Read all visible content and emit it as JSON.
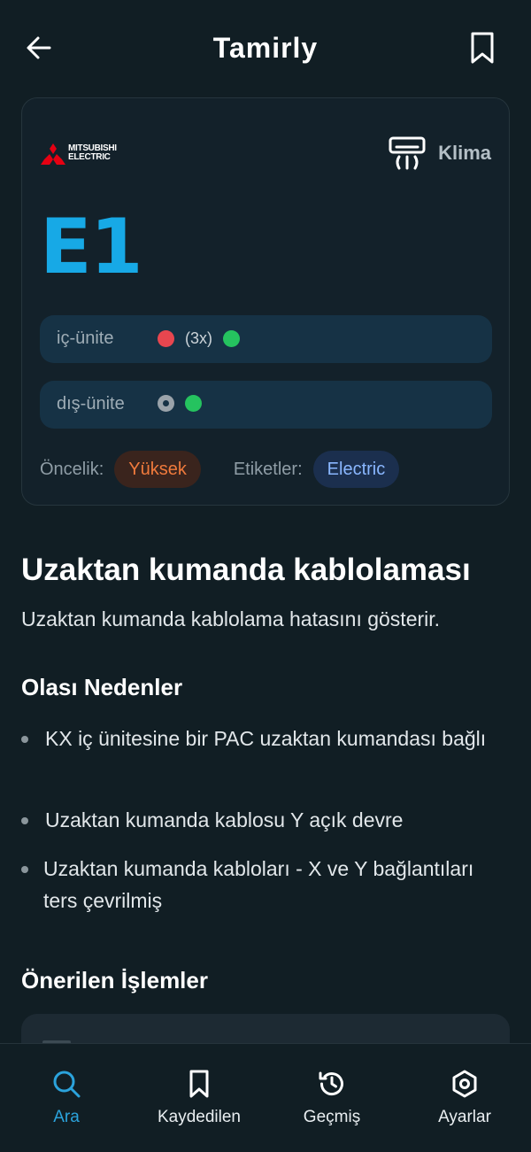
{
  "header": {
    "title": "Tamirly",
    "back_icon": "arrow-left-icon",
    "bookmark_icon": "bookmark-icon"
  },
  "card": {
    "brand_line1": "MITSUBISHI",
    "brand_line2": "ELECTRIC",
    "brand_logo_color": "#e60012",
    "category_icon": "air-conditioner-icon",
    "category": "Klima",
    "code": "E1",
    "code_color": "#17a9e6",
    "indoor": {
      "label": "iç-ünite",
      "blink": "(3x)"
    },
    "outdoor": {
      "label": "dış-ünite"
    },
    "priority_label": "Öncelik:",
    "priority": "Yüksek",
    "tags_label": "Etiketler:",
    "tag": "Electric"
  },
  "detail": {
    "title": "Uzaktan kumanda kablolaması",
    "description": "Uzaktan kumanda kablolama hatasını gösterir.",
    "causes_title": "Olası Nedenler",
    "causes": [
      "KX iç ünitesine bir PAC uzaktan kumandası bağlı",
      "Uzaktan kumanda kablosu Y açık devre",
      "Uzaktan kumanda kabloları - X ve Y bağlantıları ters çevrilmiş"
    ],
    "actions_title": "Önerilen İşlemler"
  },
  "nav": {
    "items": [
      {
        "label": "Ara",
        "icon": "search-icon",
        "active": true
      },
      {
        "label": "Kaydedilen",
        "icon": "bookmark-icon"
      },
      {
        "label": "Geçmiş",
        "icon": "history-icon"
      },
      {
        "label": "Ayarlar",
        "icon": "settings-icon"
      }
    ],
    "active_color": "#2ba3dc"
  }
}
